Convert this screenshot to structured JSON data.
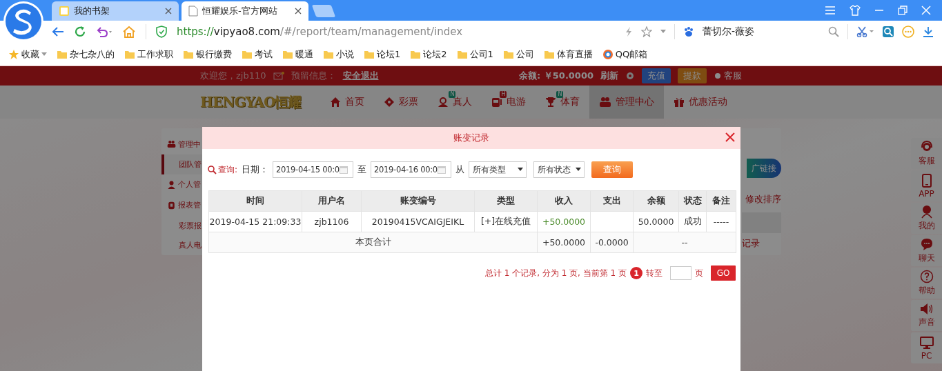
{
  "browser": {
    "tabs": [
      {
        "title": "我的书架",
        "selected": false
      },
      {
        "title": "恒耀娱乐-官方网站",
        "selected": true
      }
    ],
    "address": {
      "scheme": "https://",
      "host": "vipyao8.com",
      "path": "/#/report/team/management/index"
    },
    "search": {
      "value": "蕾切尔-薇姿"
    },
    "bookmarks": [
      {
        "label": "收藏",
        "kind": "star"
      },
      {
        "label": "杂七杂八的",
        "kind": "folder"
      },
      {
        "label": "工作求职",
        "kind": "folder"
      },
      {
        "label": "银行缴费",
        "kind": "folder"
      },
      {
        "label": "考试",
        "kind": "folder"
      },
      {
        "label": "暖通",
        "kind": "folder"
      },
      {
        "label": "小说",
        "kind": "folder"
      },
      {
        "label": "论坛1",
        "kind": "folder"
      },
      {
        "label": "论坛2",
        "kind": "folder"
      },
      {
        "label": "公司1",
        "kind": "folder"
      },
      {
        "label": "公司",
        "kind": "folder"
      },
      {
        "label": "体育直播",
        "kind": "folder"
      },
      {
        "label": "QQ邮箱",
        "kind": "site"
      }
    ]
  },
  "site": {
    "top_bar": {
      "welcome": "欢迎您，zjb110",
      "notice_label": "预留信息：",
      "logout": "安全退出",
      "balance": "余额: ￥50.0000",
      "refresh": "刷新",
      "deposit": "充值",
      "withdraw": "提款",
      "service": "客服"
    },
    "logo": "HENGYAO恒耀",
    "nav": [
      {
        "label": "首页",
        "kind": "home",
        "selected": false
      },
      {
        "label": "彩票",
        "kind": "ticket",
        "selected": false
      },
      {
        "label": "真人",
        "kind": "person",
        "selected": false,
        "badge": {
          "text": "N",
          "kind": "new"
        }
      },
      {
        "label": "电游",
        "kind": "game",
        "selected": false,
        "badge": {
          "text": "H",
          "kind": "hot"
        }
      },
      {
        "label": "体育",
        "kind": "trophy",
        "selected": false,
        "badge": {
          "text": "N",
          "kind": "new"
        }
      },
      {
        "label": "管理中心",
        "kind": "users",
        "selected": true
      },
      {
        "label": "优惠活动",
        "kind": "gift",
        "selected": false
      }
    ],
    "sidebar": [
      {
        "label": "管理中",
        "kind": "users",
        "children": [
          {
            "label": "团队管",
            "selected": true
          }
        ]
      },
      {
        "label": "个人管",
        "kind": "user"
      },
      {
        "label": "报表管",
        "kind": "report",
        "children": [
          {
            "label": "彩票报",
            "selected": false
          },
          {
            "label": "真人电",
            "selected": false
          }
        ]
      }
    ],
    "content": {
      "link_button": "广链接",
      "sort_note": "修改排序",
      "records_link": "记录"
    },
    "float_bar": [
      {
        "label": "客服",
        "kind": "headset"
      },
      {
        "label": "APP",
        "kind": "phone"
      },
      {
        "label": "我的",
        "kind": "user"
      },
      {
        "label": "聊天",
        "kind": "chat"
      },
      {
        "label": "帮助",
        "kind": "help"
      },
      {
        "label": "声音",
        "kind": "sound"
      },
      {
        "label": "PC",
        "kind": "monitor"
      }
    ]
  },
  "modal": {
    "title": "账变记录",
    "filter": {
      "query_label": "查询:",
      "date_label": "日期：",
      "date_from": "2019-04-15 00:0",
      "to_label": "至",
      "date_to": "2019-04-16 00:0",
      "from_label": "从",
      "type_select": "所有类型",
      "status_select": "所有状态",
      "submit": "查询"
    },
    "table": {
      "columns": [
        "时间",
        "用户名",
        "账变编号",
        "类型",
        "收入",
        "支出",
        "余额",
        "状态",
        "备注"
      ],
      "rows": [
        [
          "2019-04-15 21:09:33",
          "zjb1106",
          "20190415VCAIGJEIKL",
          "[+]在线充值",
          "+50.0000",
          "",
          "50.0000",
          "成功",
          "-----"
        ]
      ],
      "total": {
        "label": "本页合计",
        "income": "+50.0000",
        "expense": "-0.0000",
        "rest": "--"
      }
    },
    "pagination": {
      "summary": "总计 1 个记录, 分为 1 页, 当前第 1 页",
      "current_page": "1",
      "goto_label": "转至",
      "page_label": "页",
      "go": "GO"
    }
  }
}
